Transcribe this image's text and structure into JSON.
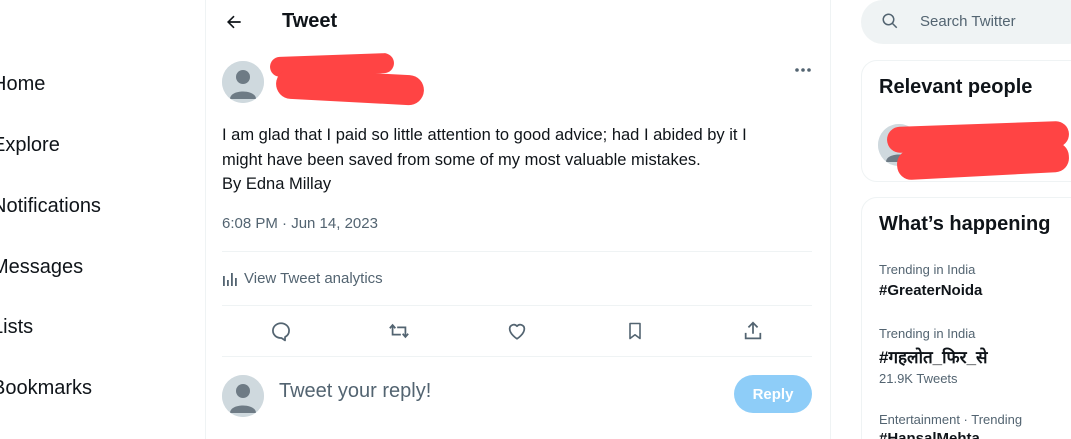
{
  "nav": {
    "items": [
      {
        "label": "Home"
      },
      {
        "label": "Explore"
      },
      {
        "label": "Notifications"
      },
      {
        "label": "Messages"
      },
      {
        "label": "Lists"
      },
      {
        "label": "Bookmarks"
      }
    ]
  },
  "header": {
    "title": "Tweet",
    "back_icon": "arrow-left-icon"
  },
  "tweet": {
    "lines": [
      "I am glad that I paid so little attention to good advice; had I abided by it I",
      "might have been saved from some of my most valuable mistakes.",
      "By Edna Millay"
    ],
    "timestamp": "6:08 PM · Jun 14, 2023",
    "analytics_label": "View Tweet analytics",
    "more_icon": "more-horizontal-icon",
    "actions": [
      "reply-icon",
      "retweet-icon",
      "like-icon",
      "bookmark-icon",
      "share-icon"
    ]
  },
  "reply_box": {
    "placeholder": "Tweet your reply!",
    "button_label": "Reply"
  },
  "search": {
    "placeholder": "Search Twitter"
  },
  "relevant_people": {
    "title": "Relevant people"
  },
  "whats_happening": {
    "title": "What’s happening",
    "trends": [
      {
        "meta": "Trending in India",
        "name": "#GreaterNoida",
        "count": ""
      },
      {
        "meta": "Trending in India",
        "name": "#गहलोत_फिर_से",
        "count": "21.9K Tweets"
      },
      {
        "meta": "Entertainment · Trending",
        "name": "#HansalMehta",
        "count": ""
      }
    ]
  },
  "colors": {
    "text": "#0f1419",
    "secondary": "#536471",
    "reply_button": "#8ecdf8",
    "redaction": "#ff4444",
    "divider": "#eff3f4"
  }
}
